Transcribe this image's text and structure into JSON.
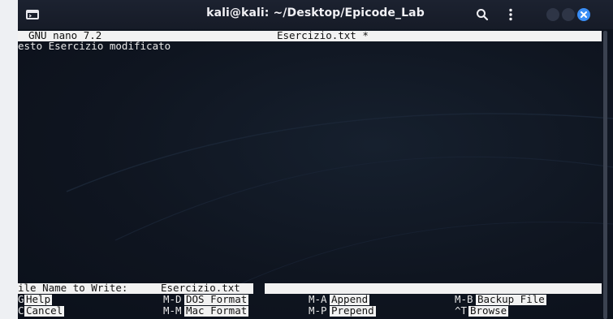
{
  "window": {
    "title": "kali@kali: ~/Desktop/Epicode_Lab"
  },
  "nano": {
    "version_label": "GNU nano 7.2",
    "filename_modified": "Esercizio.txt *",
    "content_line": "esto Esercizio modificato",
    "prompt_label": "ile Name to Write: ",
    "prompt_value": "Esercizio.txt",
    "shortcuts_row1": [
      {
        "key": "G",
        "label": "Help"
      },
      {
        "key": "M-D",
        "label": "DOS Format"
      },
      {
        "key": "M-A",
        "label": "Append"
      },
      {
        "key": "M-B",
        "label": "Backup File"
      }
    ],
    "shortcuts_row2": [
      {
        "key": "C",
        "label": "Cancel"
      },
      {
        "key": "M-M",
        "label": "Mac Format"
      },
      {
        "key": "M-P",
        "label": "Prepend"
      },
      {
        "key": "^T",
        "label": "Browse"
      }
    ]
  },
  "icons": {
    "terminal": "terminal-icon",
    "search": "search-icon",
    "menu": "vertical-ellipsis-icon",
    "minimize": "minimize-icon",
    "maximize": "maximize-icon",
    "close": "close-icon"
  },
  "colors": {
    "accent_close": "#3a8ef6",
    "terminal_bg": "#101622",
    "inverse_bar": "#f2f2f2"
  }
}
